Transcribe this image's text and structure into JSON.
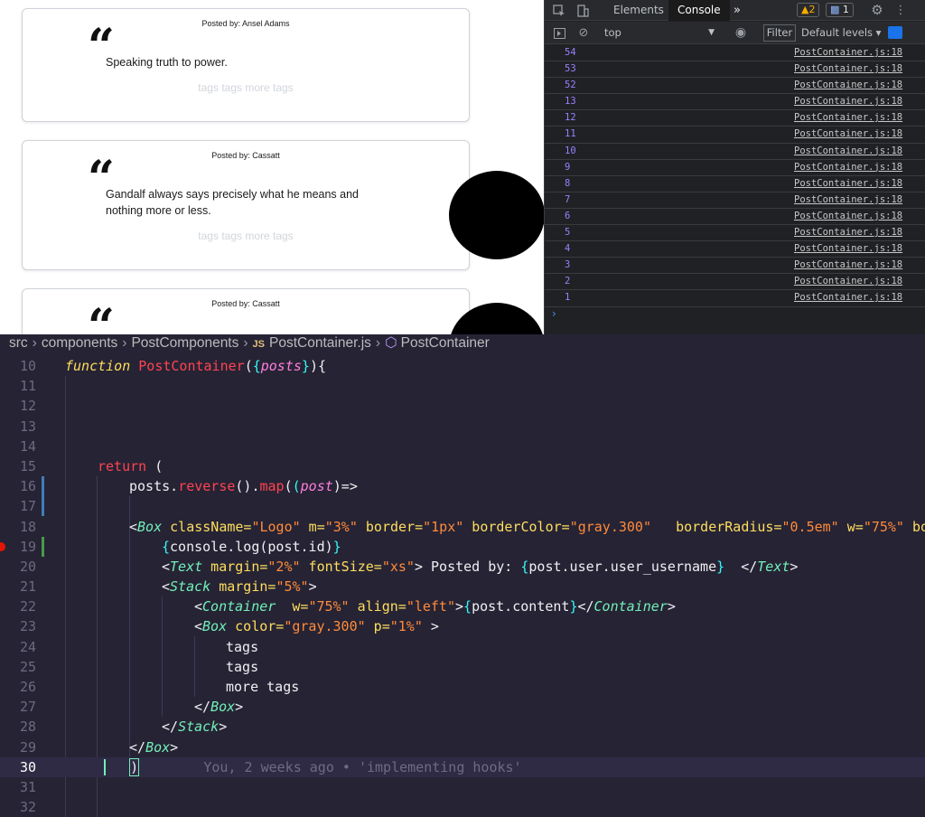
{
  "app": {
    "posts": [
      {
        "author": "Posted by: Ansel Adams",
        "quote_mark": "“",
        "content": "Speaking truth to power.",
        "tags": "tags tags more tags"
      },
      {
        "author": "Posted by: Cassatt",
        "quote_mark": "“",
        "content": "Gandalf always says precisely what he means and nothing more or less.",
        "tags": "tags tags more tags"
      },
      {
        "author": "Posted by: Cassatt",
        "quote_mark": "“",
        "content": "",
        "tags": ""
      }
    ]
  },
  "devtools": {
    "tabs": [
      "Elements",
      "Console"
    ],
    "active_tab": "Console",
    "more_tabs_icon": "»",
    "warning_badge": "▲2",
    "message_badge": "1",
    "context": "top",
    "filter_label": "Filter",
    "levels_label": "Default levels ▾",
    "logs": [
      {
        "value": "54",
        "source": "PostContainer.js:18"
      },
      {
        "value": "53",
        "source": "PostContainer.js:18"
      },
      {
        "value": "52",
        "source": "PostContainer.js:18"
      },
      {
        "value": "13",
        "source": "PostContainer.js:18"
      },
      {
        "value": "12",
        "source": "PostContainer.js:18"
      },
      {
        "value": "11",
        "source": "PostContainer.js:18"
      },
      {
        "value": "10",
        "source": "PostContainer.js:18"
      },
      {
        "value": "9",
        "source": "PostContainer.js:18"
      },
      {
        "value": "8",
        "source": "PostContainer.js:18"
      },
      {
        "value": "7",
        "source": "PostContainer.js:18"
      },
      {
        "value": "6",
        "source": "PostContainer.js:18"
      },
      {
        "value": "5",
        "source": "PostContainer.js:18"
      },
      {
        "value": "4",
        "source": "PostContainer.js:18"
      },
      {
        "value": "3",
        "source": "PostContainer.js:18"
      },
      {
        "value": "2",
        "source": "PostContainer.js:18"
      },
      {
        "value": "1",
        "source": "PostContainer.js:18"
      }
    ],
    "prompt": "›"
  },
  "editor": {
    "breadcrumb": [
      "src",
      "components",
      "PostComponents",
      "PostContainer.js",
      "PostContainer"
    ],
    "js_badge": "JS",
    "line_numbers": [
      "10",
      "11",
      "12",
      "13",
      "14",
      "15",
      "16",
      "17",
      "18",
      "19",
      "20",
      "21",
      "22",
      "23",
      "24",
      "25",
      "26",
      "27",
      "28",
      "29",
      "30",
      "31",
      "32"
    ],
    "current_line": "30",
    "blame": "You, 2 weeks ago • 'implementing hooks'",
    "code": {
      "l10": {
        "kw": "function",
        "fn": "PostContainer",
        "p1": "(",
        "b1": "{",
        "param": "posts",
        "b2": "}",
        "p2": "){"
      },
      "l15": {
        "ret": "return",
        "p": " ("
      },
      "l16": {
        "obj": "posts.",
        "m1": "reverse",
        "p1": "().",
        "m2": "map",
        "p2": "(",
        "p3": "(",
        "param": "post",
        "p4": ")=>"
      },
      "l18": {
        "open": "<",
        "tag": "Box",
        "a1": " className=",
        "v1": "\"Logo\"",
        "a2": " m=",
        "v2": "\"3%\"",
        "a3": " border=",
        "v3": "\"1px\"",
        "a4": " borderColor=",
        "v4": "\"gray.300\"",
        "a5": "   borderRadius=",
        "v5": "\"0.5em\"",
        "a6": " w=",
        "v6": "\"75%\"",
        "a7": " box"
      },
      "l19": {
        "b1": "{",
        "txt": "console.log(post.id)",
        "b2": "}"
      },
      "l20": {
        "open": "<",
        "tag": "Text",
        "a1": " margin=",
        "v1": "\"2%\"",
        "a2": " fontSize=",
        "v2": "\"xs\"",
        "t1": "> Posted by: ",
        "b1": "{",
        "expr": "post.user.user_username",
        "b2": "}",
        "t2": "  </",
        "ctag": "Text",
        "t3": ">"
      },
      "l21": {
        "open": "<",
        "tag": "Stack",
        "a1": " margin=",
        "v1": "\"5%\"",
        "t1": ">"
      },
      "l22": {
        "open": "<",
        "tag": "Container",
        "a1": "  w=",
        "v1": "\"75%\"",
        "a2": " align=",
        "v2": "\"left\"",
        "t1": ">",
        "b1": "{",
        "expr": "post.content",
        "b2": "}",
        "t2": "</",
        "ctag": "Container",
        "t3": ">"
      },
      "l23": {
        "open": "<",
        "tag": "Box",
        "a1": " color=",
        "v1": "\"gray.300\"",
        "a2": " p=",
        "v2": "\"1%\"",
        "t1": " >"
      },
      "l24": "tags",
      "l25": "tags",
      "l26": "more tags",
      "l27": {
        "open": "</",
        "tag": "Box",
        "t1": ">"
      },
      "l28": {
        "open": "</",
        "tag": "Stack",
        "t1": ">"
      },
      "l29": {
        "open": "</",
        "tag": "Box",
        "t1": ">"
      },
      "l30": ")"
    }
  }
}
